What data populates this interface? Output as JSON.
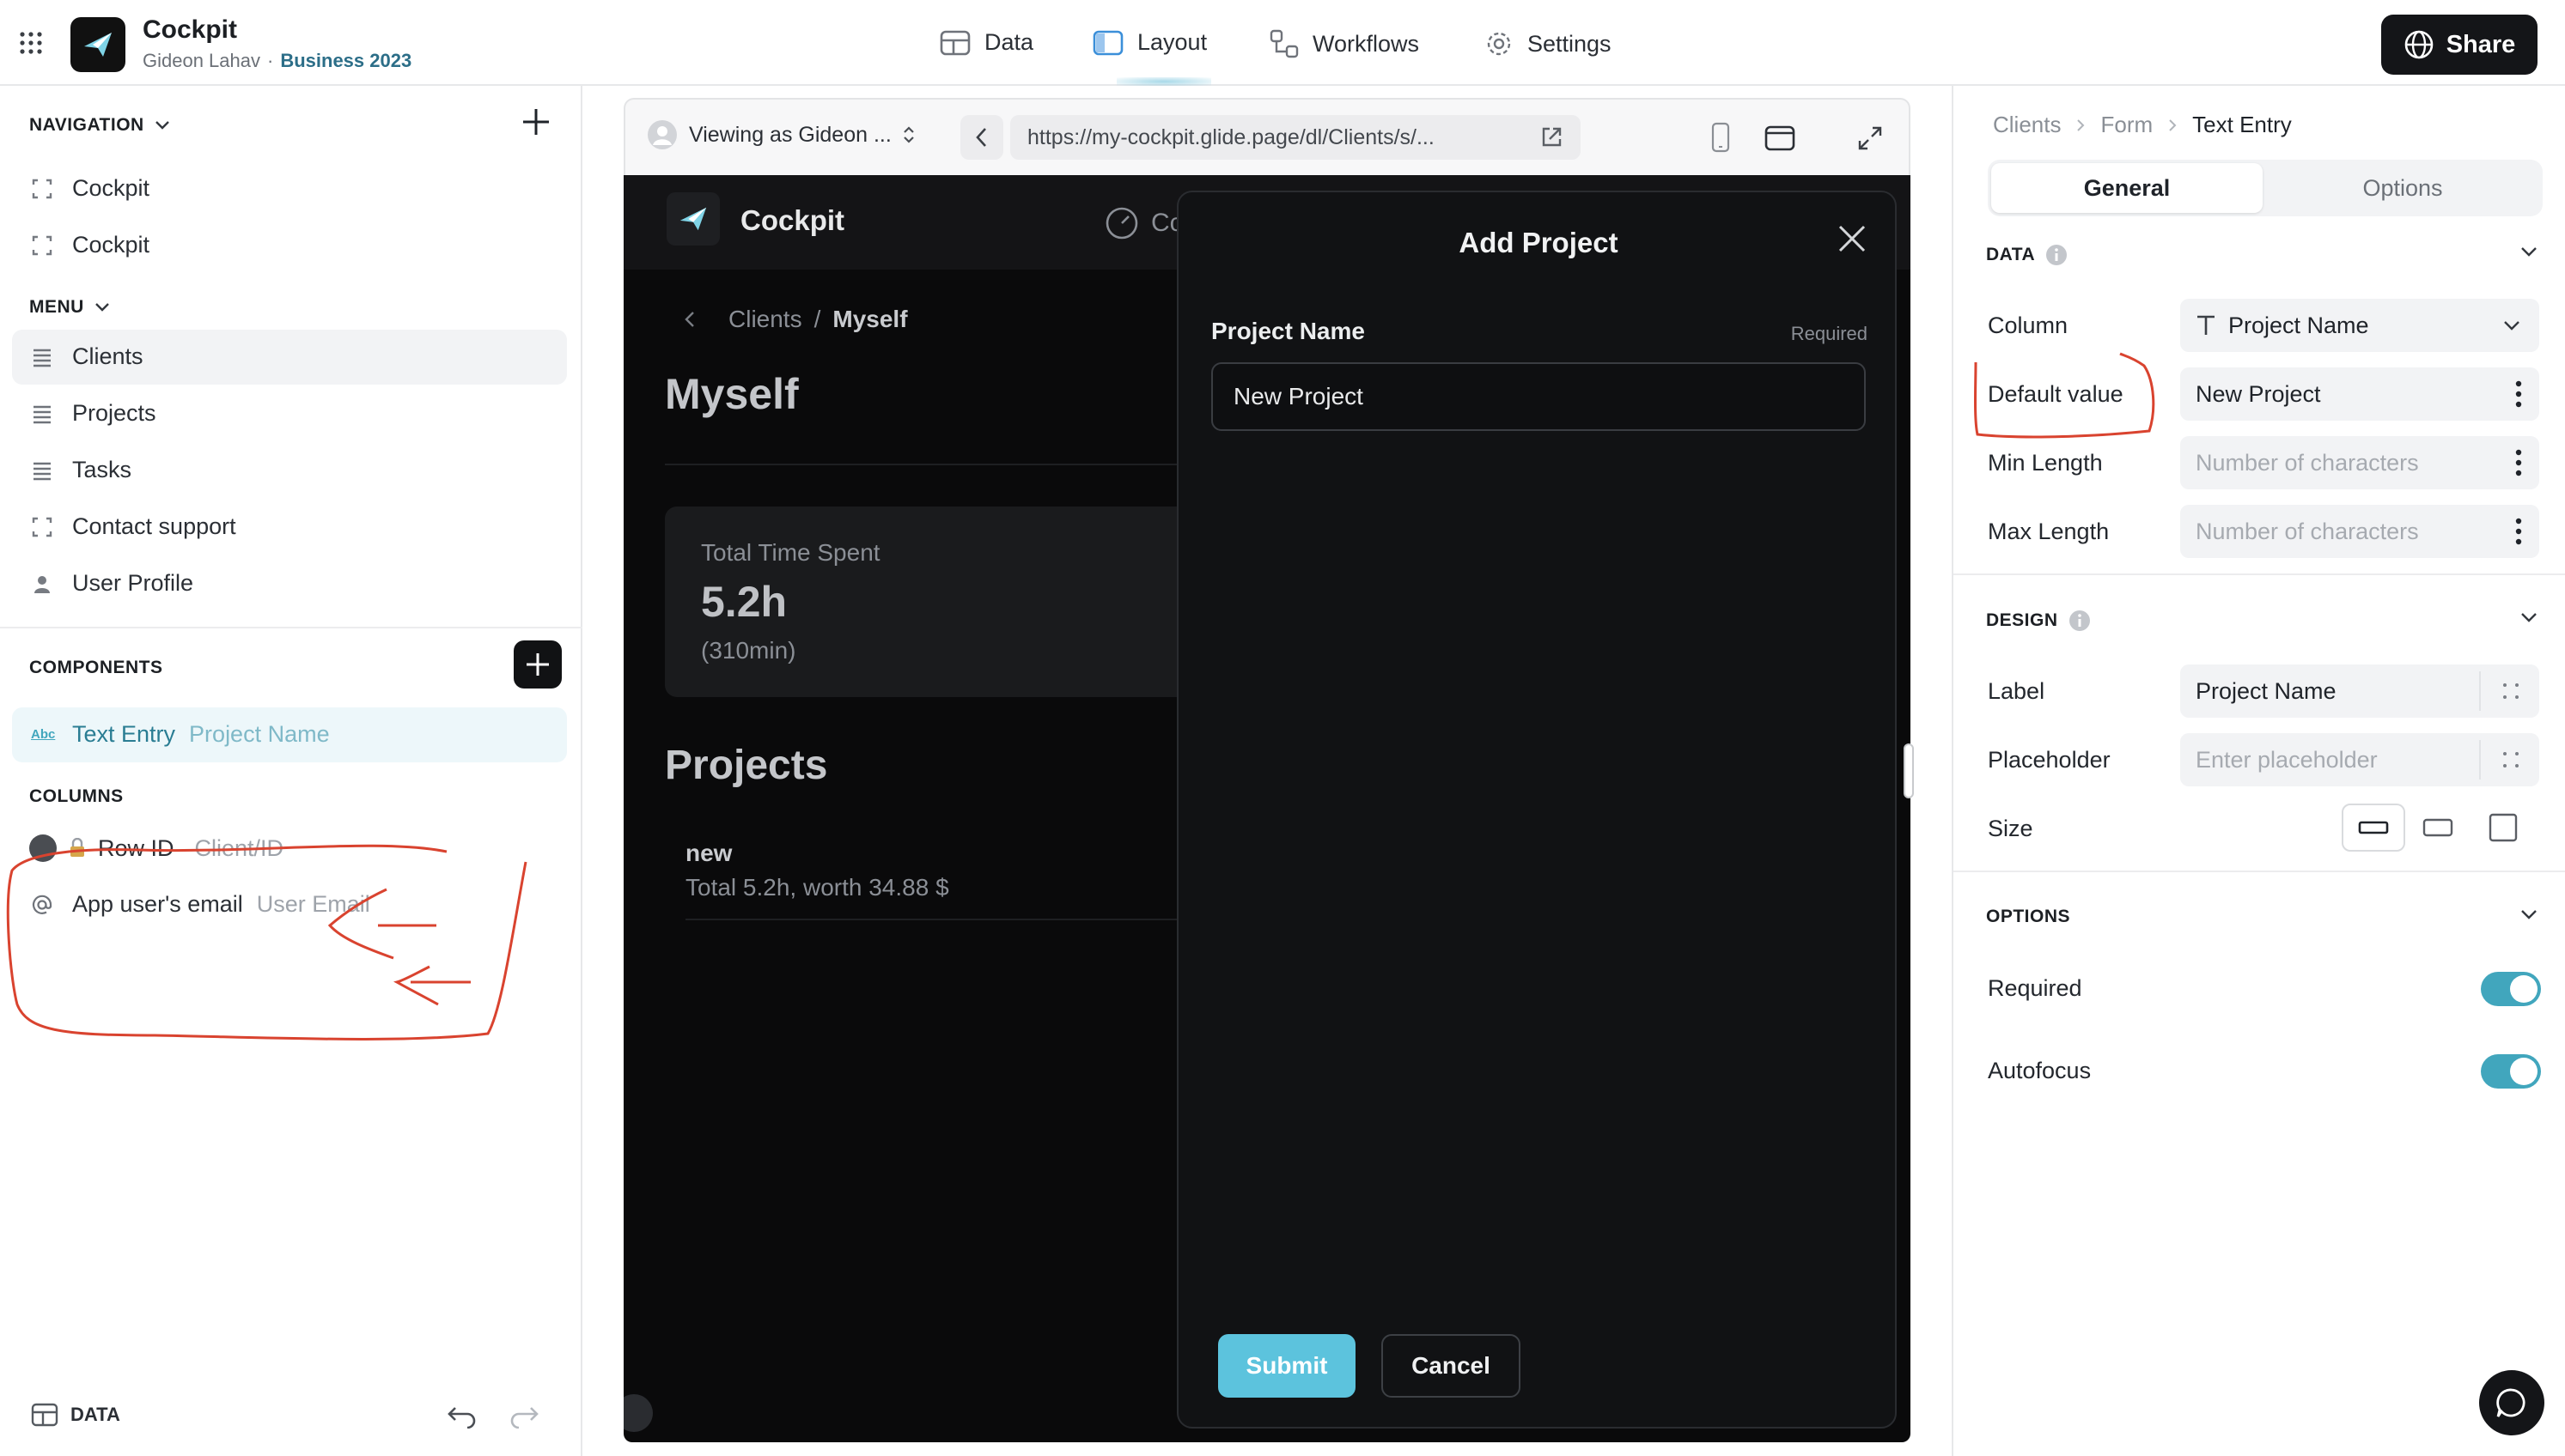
{
  "app": {
    "title": "Cockpit",
    "owner": "Gideon Lahav",
    "separator": "·",
    "plan": "Business 2023"
  },
  "top_tabs": [
    {
      "label": "Data",
      "icon": "table-icon"
    },
    {
      "label": "Layout",
      "icon": "layout-icon",
      "active": true
    },
    {
      "label": "Workflows",
      "icon": "workflow-icon"
    },
    {
      "label": "Settings",
      "icon": "gear-icon"
    }
  ],
  "share_label": "Share",
  "left": {
    "navigation_header": "NAVIGATION",
    "navigation": [
      "Cockpit",
      "Cockpit"
    ],
    "menu_header": "MENU",
    "menu": [
      "Clients",
      "Projects",
      "Tasks",
      "Contact support",
      "User Profile"
    ],
    "components_header": "COMPONENTS",
    "component": {
      "name": "Text Entry",
      "detail": "Project Name",
      "badge": "Abc"
    },
    "columns_header": "COLUMNS",
    "columns": [
      {
        "name": "Row ID",
        "detail": "Client/ID"
      },
      {
        "name": "App user's email",
        "detail": "User Email"
      }
    ],
    "footer_label": "DATA"
  },
  "preview": {
    "viewing_as": "Viewing as Gideon ...",
    "url": "https://my-cockpit.glide.page/dl/Clients/s/...",
    "app_name": "Cockpit",
    "nav_partial": "Cc",
    "breadcrumb": {
      "parent": "Clients",
      "sep": "/",
      "current": "Myself"
    },
    "heading": "Myself",
    "metric": {
      "label": "Total Time Spent",
      "value": "5.2h",
      "sub": "(310min)"
    },
    "projects_heading": "Projects",
    "project": {
      "title": "new",
      "subtitle": "Total 5.2h, worth 34.88 $"
    }
  },
  "modal": {
    "title": "Add Project",
    "field_label": "Project Name",
    "required": "Required",
    "field_value": "New Project",
    "submit": "Submit",
    "cancel": "Cancel"
  },
  "right": {
    "breadcrumb": [
      "Clients",
      "Form",
      "Text Entry"
    ],
    "tabs": {
      "general": "General",
      "options": "Options"
    },
    "data_header": "DATA",
    "column_label": "Column",
    "column_value": "Project Name",
    "default_label": "Default value",
    "default_value": "New Project",
    "min_label": "Min Length",
    "min_placeholder": "Number of characters",
    "max_label": "Max Length",
    "max_placeholder": "Number of characters",
    "design_header": "DESIGN",
    "label_label": "Label",
    "label_value": "Project Name",
    "placeholder_label": "Placeholder",
    "placeholder_placeholder": "Enter placeholder",
    "size_label": "Size",
    "options_header": "OPTIONS",
    "required_label": "Required",
    "autofocus_label": "Autofocus"
  },
  "colors": {
    "accent": "#41a6bd",
    "submit": "#5cc3dd",
    "annotation": "#d9432f",
    "dark_bg": "#0a0a0b"
  }
}
